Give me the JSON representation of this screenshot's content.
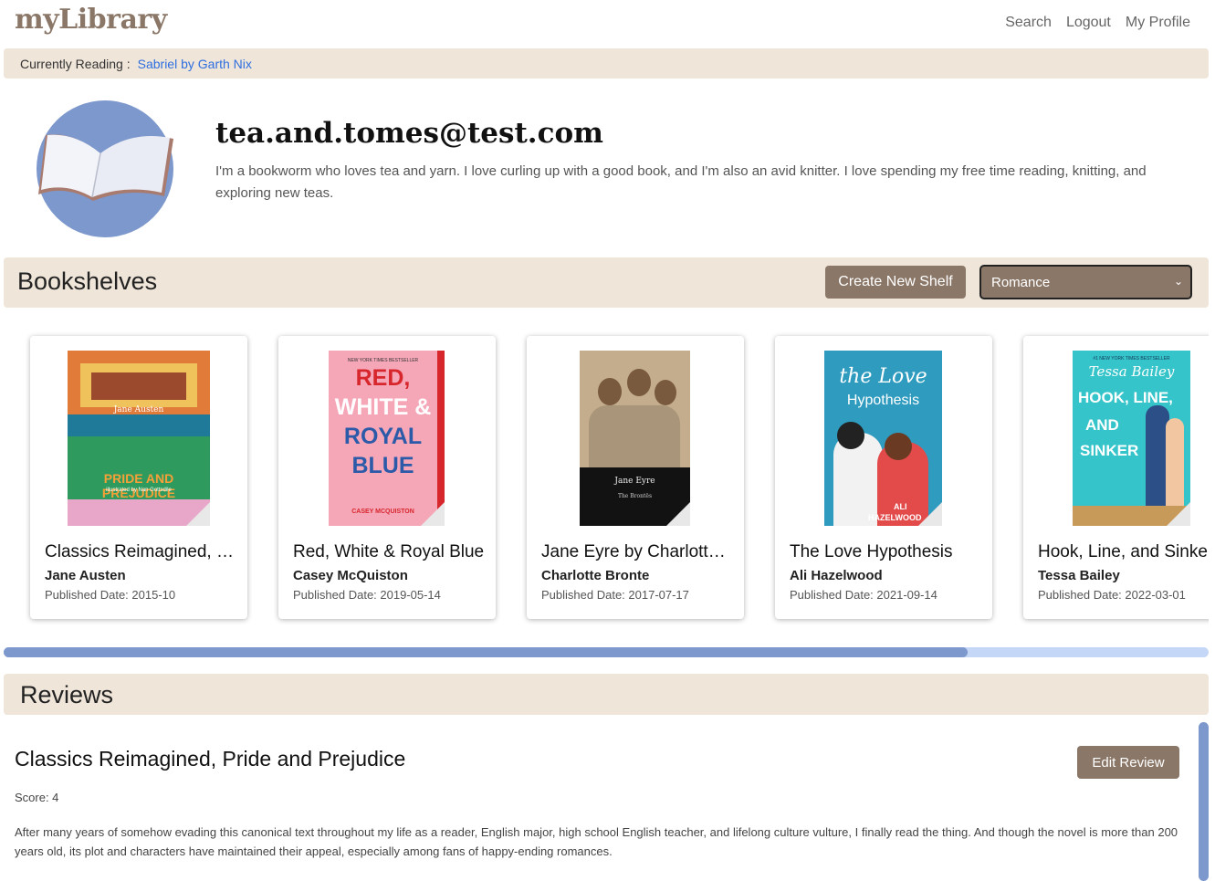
{
  "header": {
    "logo": "myLibrary",
    "nav": [
      "Search",
      "Logout",
      "My Profile"
    ]
  },
  "currently_reading": {
    "label": "Currently Reading :",
    "book": "Sabriel by Garth Nix"
  },
  "profile": {
    "avatar_icon": "open-book-icon",
    "name": "tea.and.tomes@test.com",
    "bio": "I'm a bookworm who loves tea and yarn. I love curling up with a good book, and I'm also an avid knitter. I love spending my free time reading, knitting, and exploring new teas."
  },
  "bookshelves": {
    "title": "Bookshelves",
    "create_button": "Create New Shelf",
    "selected_shelf": "Romance",
    "books": [
      {
        "title": "Classics Reimagined, Pride and Prejudice",
        "author": "Jane Austen",
        "published": "Published Date: 2015-10",
        "cover_text": [
          "Jane Austen",
          "PRIDE AND PREJUDICE",
          "illustrated by Nan Gottsdile"
        ]
      },
      {
        "title": "Red, White & Royal Blue",
        "author": "Casey McQuiston",
        "published": "Published Date: 2019-05-14",
        "cover_text": [
          "NEW YORK TIMES BESTSELLER",
          "RED,",
          "WHITE",
          "&",
          "ROYAL",
          "BLUE",
          "CASEY MCQUISTON"
        ]
      },
      {
        "title": "Jane Eyre by Charlotte Bronte",
        "author": "Charlotte Bronte",
        "published": "Published Date: 2017-07-17",
        "cover_text": [
          "Jane Eyre",
          "The Brontës"
        ]
      },
      {
        "title": "The Love Hypothesis",
        "author": "Ali Hazelwood",
        "published": "Published Date: 2021-09-14",
        "cover_text": [
          "the Love",
          "Hypothesis",
          "ALI",
          "HAZELWOOD"
        ]
      },
      {
        "title": "Hook, Line, and Sinker",
        "author": "Tessa Bailey",
        "published": "Published Date: 2022-03-01",
        "cover_text": [
          "#1 NEW YORK TIMES BESTSELLER",
          "Tessa Bailey",
          "HOOK, LINE,",
          "AND",
          "SINKER"
        ]
      }
    ]
  },
  "scroll": {
    "horizontal_fraction": 0.8
  },
  "reviews": {
    "title": "Reviews",
    "items": [
      {
        "book_title": "Classics Reimagined, Pride and Prejudice",
        "edit_button": "Edit Review",
        "score": "Score: 4",
        "text": "After many years of somehow evading this canonical text throughout my life as a reader, English major, high school English teacher, and lifelong culture vulture, I finally read the thing. And though the novel is more than 200 years old, its plot and characters have maintained their appeal, especially among fans of happy-ending romances."
      }
    ]
  },
  "colors": {
    "accent_brown": "#8b7768",
    "bar_beige": "#efe5d9",
    "avatar_blue": "#7d98cc",
    "link_blue": "#2f6fe0"
  }
}
